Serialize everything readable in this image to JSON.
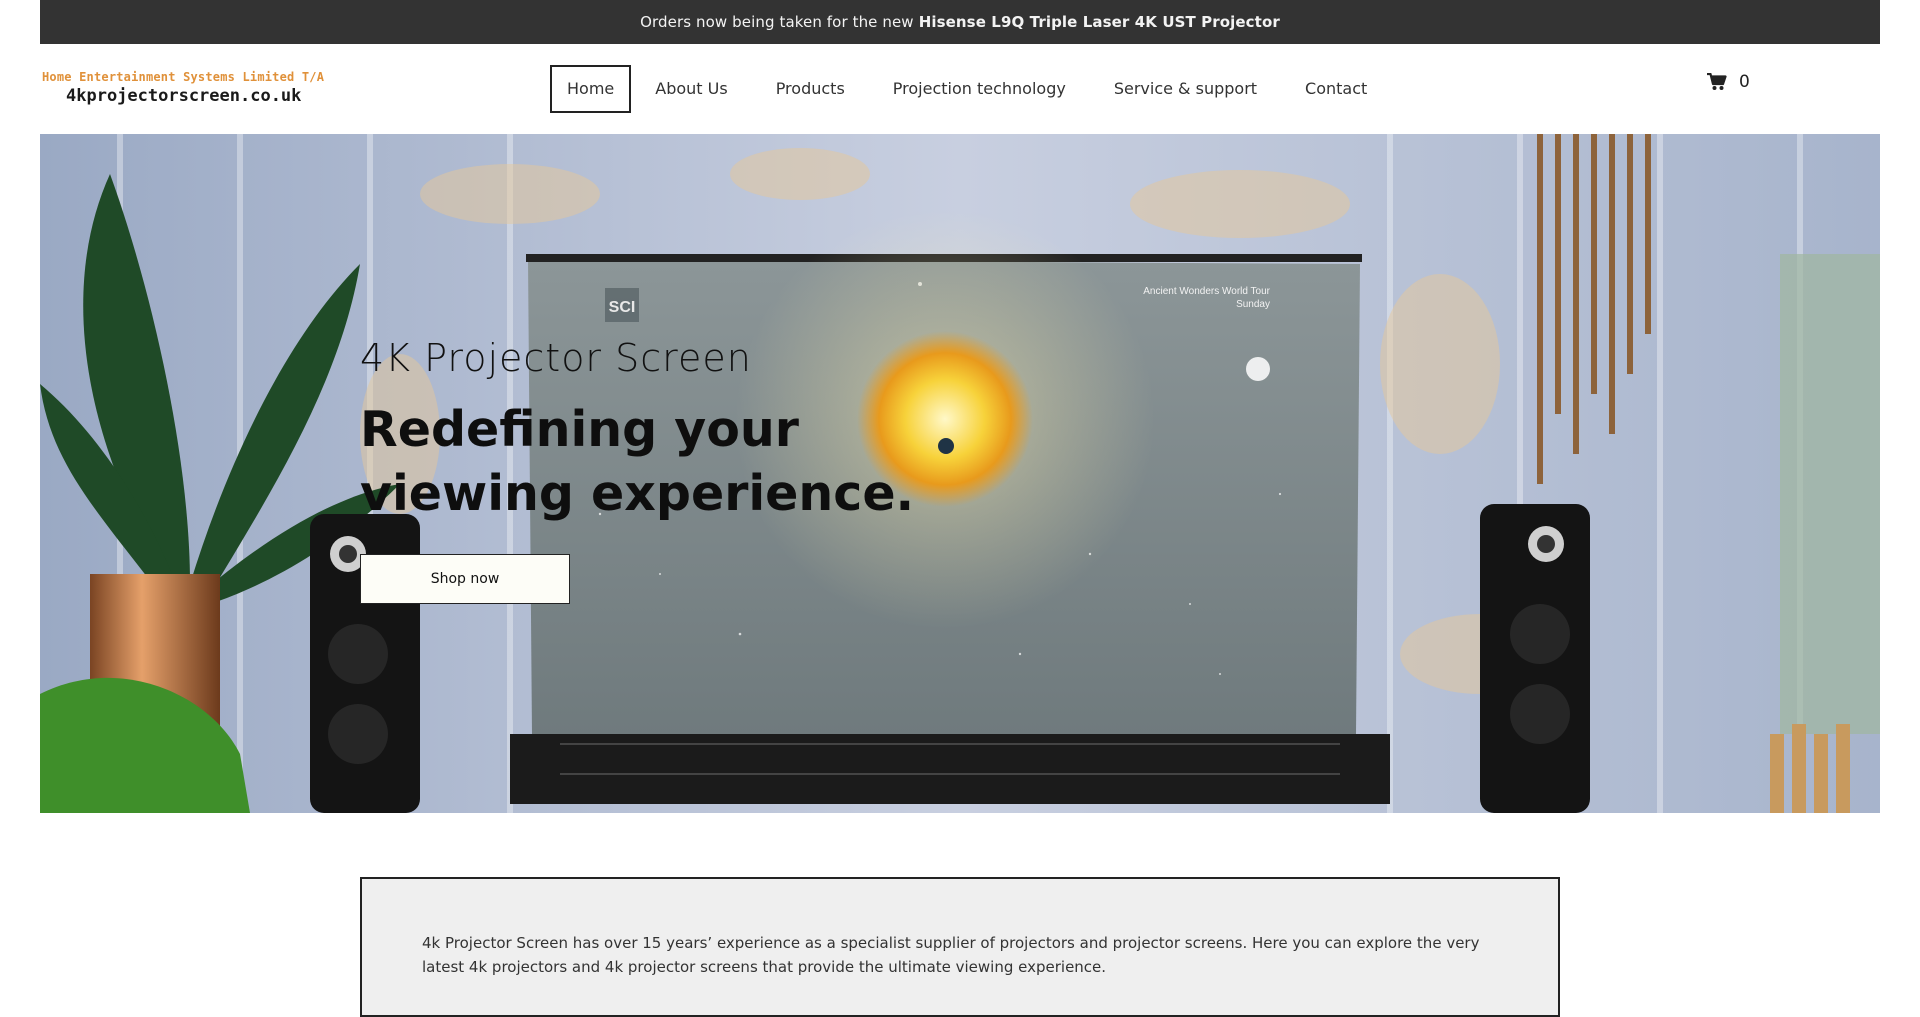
{
  "announcement": {
    "prefix": "Orders now being taken for the new",
    "product": "Hisense L9Q Triple Laser 4K UST Projector"
  },
  "logo": {
    "line1": "Home Entertainment Systems Limited T/A",
    "line2": "4kprojectorscreen.co.uk"
  },
  "nav": {
    "items": [
      {
        "label": "Home"
      },
      {
        "label": "About Us"
      },
      {
        "label": "Products"
      },
      {
        "label": "Projection technology"
      },
      {
        "label": "Service & support"
      },
      {
        "label": "Contact"
      }
    ],
    "active": "Home"
  },
  "cart": {
    "count": "0",
    "icon": "cart-icon"
  },
  "hero": {
    "subtitle": "4K Projector Screen",
    "title_line1": "Redefining your",
    "title_line2": "viewing experience.",
    "button": "Shop now",
    "screen_text_line1": "Ancient Wonders World Tour",
    "screen_text_line2": "Sunday",
    "screen_logo_text": "SCI"
  },
  "intro": {
    "text": "4k Projector Screen has over 15 years’ experience as a specialist supplier of projectors and projector screens. Here you can explore the very latest 4k projectors and 4k projector screens that provide the ultimate viewing experience."
  },
  "colors": {
    "announce_bg": "#333333",
    "logo_accent": "#e0913a",
    "intro_bg": "#efefef"
  }
}
